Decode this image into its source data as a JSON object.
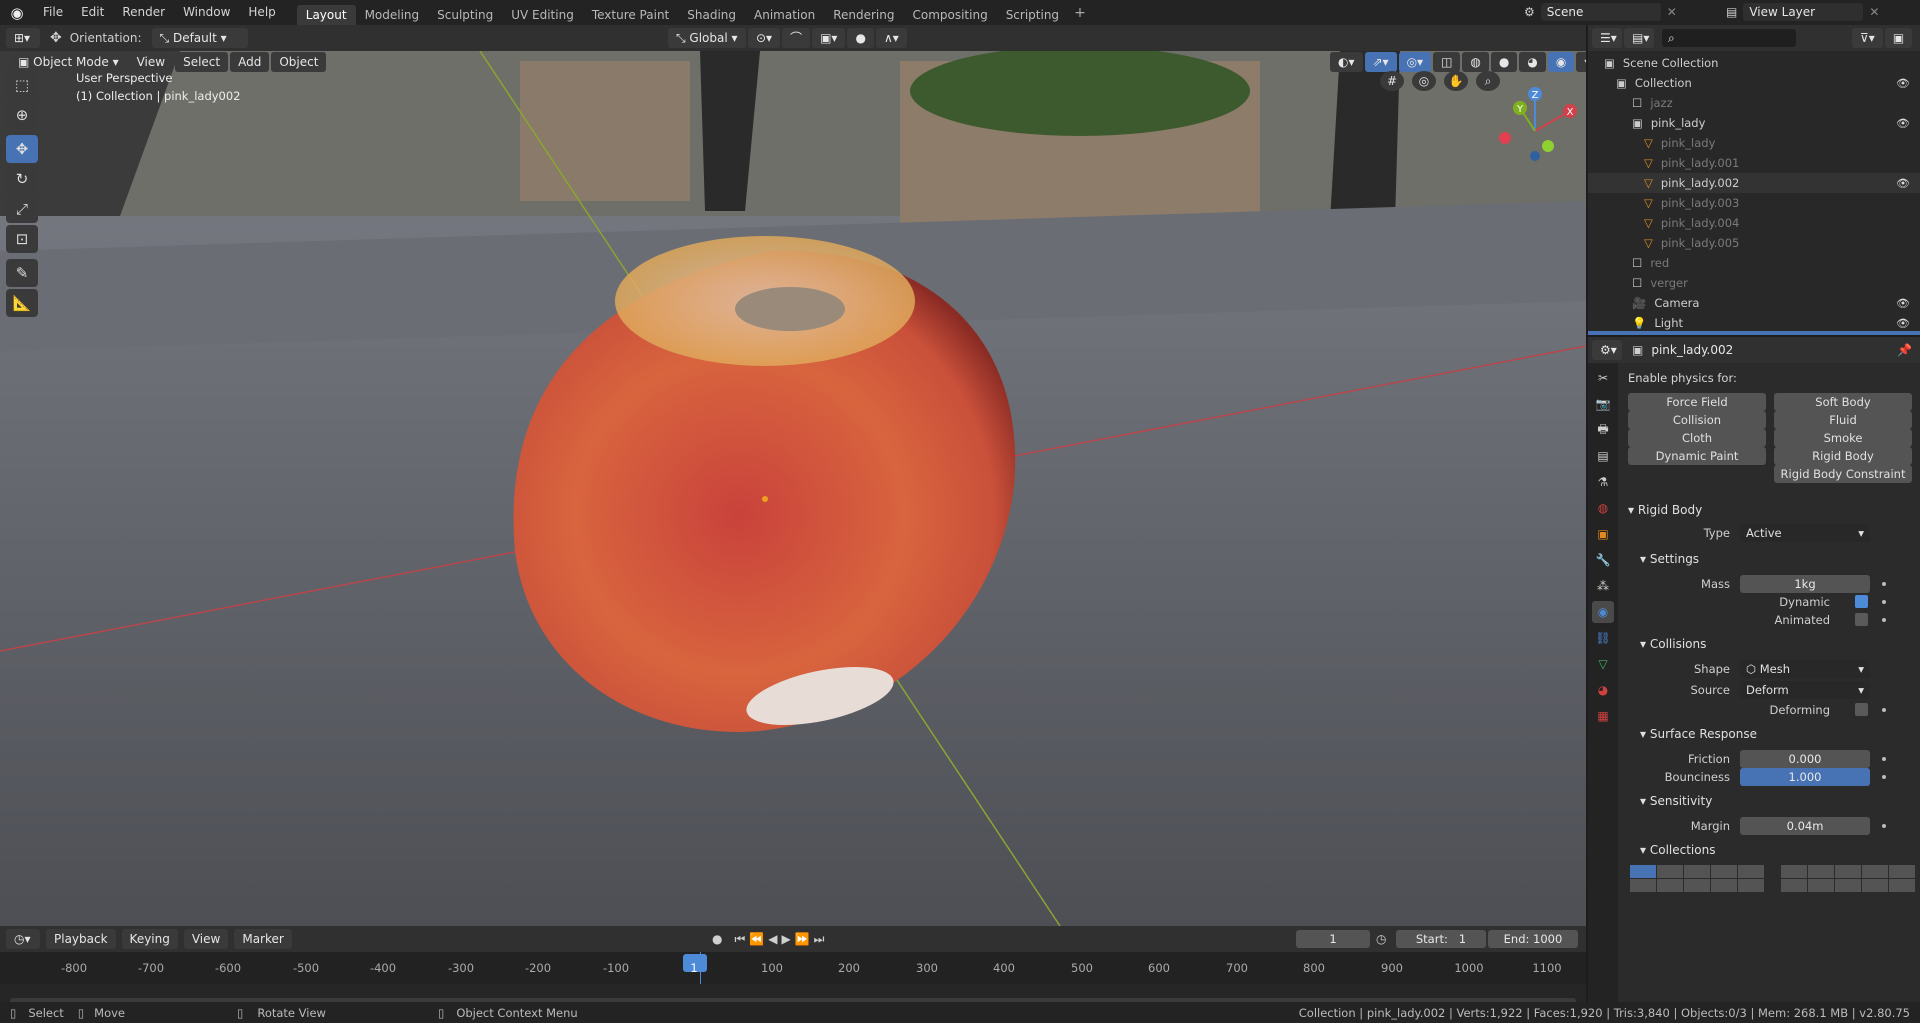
{
  "top_menu": [
    "File",
    "Edit",
    "Render",
    "Window",
    "Help"
  ],
  "workspaces": [
    "Layout",
    "Modeling",
    "Sculpting",
    "UV Editing",
    "Texture Paint",
    "Shading",
    "Animation",
    "Rendering",
    "Compositing",
    "Scripting"
  ],
  "active_workspace": "Layout",
  "scene_name": "Scene",
  "view_layer": "View Layer",
  "header": {
    "orientation_label": "Orientation:",
    "orientation_value": "Default",
    "transform_orient": "Global"
  },
  "viewport_menu": {
    "mode": "Object Mode",
    "items": [
      "View",
      "Select",
      "Add",
      "Object"
    ]
  },
  "viewport_overlay": {
    "perspective": "User Perspective",
    "collection_info": "(1) Collection | pink_lady002"
  },
  "gizmo": {
    "z": "Z",
    "x": "X",
    "y": "Y"
  },
  "outliner": {
    "search_placeholder": "",
    "rows": [
      {
        "label": "Scene Collection",
        "dim": false
      },
      {
        "label": "Collection",
        "dim": false
      },
      {
        "label": "jazz",
        "dim": true
      },
      {
        "label": "pink_lady",
        "dim": false
      },
      {
        "label": "pink_lady",
        "dim": true
      },
      {
        "label": "pink_lady.001",
        "dim": true
      },
      {
        "label": "pink_lady.002",
        "dim": false
      },
      {
        "label": "pink_lady.003",
        "dim": true
      },
      {
        "label": "pink_lady.004",
        "dim": true
      },
      {
        "label": "pink_lady.005",
        "dim": true
      },
      {
        "label": "red",
        "dim": true
      },
      {
        "label": "verger",
        "dim": true
      },
      {
        "label": "Camera",
        "dim": false
      },
      {
        "label": "Light",
        "dim": false
      }
    ]
  },
  "properties": {
    "object_name": "pink_lady.002",
    "enable_physics_label": "Enable physics for:",
    "physics_buttons": [
      "Force Field",
      "Soft Body",
      "Collision",
      "Fluid",
      "Cloth",
      "Smoke",
      "Dynamic Paint",
      "Rigid Body",
      "Rigid Body Constraint"
    ],
    "rigid_body": {
      "title": "Rigid Body",
      "type_label": "Type",
      "type_value": "Active",
      "settings_title": "Settings",
      "mass_label": "Mass",
      "mass_value": "1kg",
      "dynamic_label": "Dynamic",
      "dynamic_on": true,
      "animated_label": "Animated",
      "animated_on": false,
      "collisions_title": "Collisions",
      "shape_label": "Shape",
      "shape_value": "Mesh",
      "source_label": "Source",
      "source_value": "Deform",
      "deforming_label": "Deforming",
      "surface_title": "Surface Response",
      "friction_label": "Friction",
      "friction_value": "0.000",
      "bounciness_label": "Bounciness",
      "bounciness_value": "1.000",
      "bounciness_fraction": 1.0,
      "sensitivity_title": "Sensitivity",
      "margin_label": "Margin",
      "margin_value": "0.04m",
      "collections_title": "Collections"
    }
  },
  "timeline": {
    "menus": [
      "Playback",
      "Keying",
      "View",
      "Marker"
    ],
    "current_frame": "1",
    "start_label": "Start:",
    "start_value": "1",
    "end_label": "End:",
    "end_value": "1000",
    "ticks": [
      "-800",
      "-700",
      "-600",
      "-500",
      "-400",
      "-300",
      "-200",
      "-100",
      "1",
      "100",
      "200",
      "300",
      "400",
      "500",
      "600",
      "700",
      "800",
      "900",
      "1000",
      "1100"
    ]
  },
  "status": {
    "select": "Select",
    "move": "Move",
    "rotate": "Rotate View",
    "context": "Object Context Menu",
    "info": "Collection | pink_lady.002 | Verts:1,922 | Faces:1,920 | Tris:3,840 | Objects:0/3 | Mem: 268.1 MB | v2.80.75"
  }
}
